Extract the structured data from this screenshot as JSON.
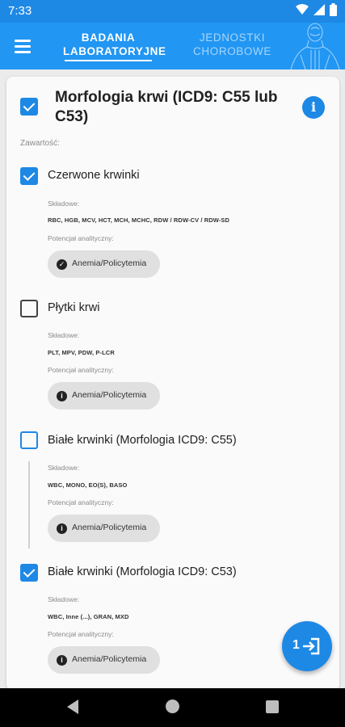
{
  "status_bar": {
    "time": "7:33",
    "icons": [
      "wifi-icon",
      "signal-icon",
      "battery-icon"
    ]
  },
  "header": {
    "menu_icon": "hamburger-menu-icon",
    "tabs": [
      {
        "label": "BADANIA LABORATORYJNE",
        "active": true
      },
      {
        "label": "JEDNOSTKI CHOROBOWE",
        "active": false
      }
    ],
    "decoration": "anatomy-figure-icon"
  },
  "card": {
    "title": "Morfologia krwi (ICD9: C55 lub C53)",
    "checked": true,
    "info_icon": "info-icon",
    "contents_label": "Zawartość:",
    "sections": [
      {
        "title": "Czerwone krwinki",
        "checked": true,
        "components_label": "Składowe:",
        "components": "RBC, HGB, MCV, HCT, MCH, MCHC, RDW / RDW-CV / RDW-SD",
        "potential_label": "Potencjał analityczny:",
        "chip": {
          "label": "Anemia/Policytemia",
          "icon": "check-circle-icon"
        }
      },
      {
        "title": "Płytki krwi",
        "checked": false,
        "components_label": "Składowe:",
        "components": "PLT, MPV, PDW, P-LCR",
        "potential_label": "Potencjał analityczny:",
        "chip": {
          "label": "Anemia/Policytemia",
          "icon": "info-icon"
        }
      },
      {
        "title": "Białe krwinki (Morfologia ICD9: C55)",
        "checked": false,
        "components_label": "Składowe:",
        "components": "WBC, MONO, EO(S), BASO",
        "potential_label": "Potencjał analityczny:",
        "chip": {
          "label": "Anemia/Policytemia",
          "icon": "info-icon"
        }
      },
      {
        "title": "Białe krwinki (Morfologia ICD9: C53)",
        "checked": true,
        "components_label": "Składowe:",
        "components": "WBC, Inne (...), GRAN, MXD",
        "potential_label": "Potencjał analityczny:",
        "chip": {
          "label": "Anemia/Policytemia",
          "icon": "info-icon"
        }
      }
    ]
  },
  "fab": {
    "count": "1",
    "icon": "login-arrow-icon"
  },
  "nav": {
    "icons": [
      "back-icon",
      "home-icon",
      "recents-icon"
    ]
  },
  "colors": {
    "primary": "#2196f3",
    "accent": "#1e88e5",
    "chip_bg": "#e0e0e0"
  }
}
